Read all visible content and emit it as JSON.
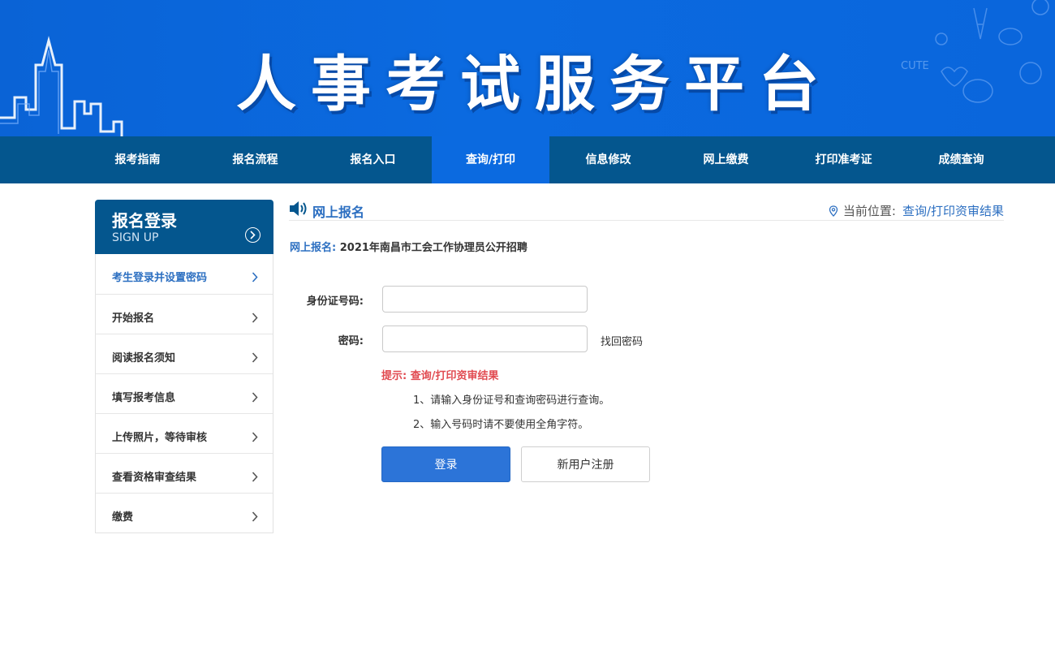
{
  "banner": {
    "title": "人事考试服务平台"
  },
  "nav": {
    "items": [
      "报考指南",
      "报名流程",
      "报名入口",
      "查询/打印",
      "信息修改",
      "网上缴费",
      "打印准考证",
      "成绩查询"
    ],
    "active_index": 3
  },
  "sidebar": {
    "title": "报名登录",
    "subtitle": "SIGN UP",
    "items": [
      "考生登录并设置密码",
      "开始报名",
      "阅读报名须知",
      "填写报考信息",
      "上传照片，等待审核",
      "查看资格审查结果",
      "缴费"
    ],
    "active_index": 0
  },
  "content": {
    "section_title": "网上报名",
    "breadcrumb_label": "当前位置:",
    "breadcrumb_current": "查询/打印资审结果",
    "exam_label": "网上报名:",
    "exam_name": "2021年南昌市工会工作协理员公开招聘"
  },
  "form": {
    "id_label": "身份证号码:",
    "id_value": "",
    "password_label": "密码:",
    "password_value": "",
    "recover_link": "找回密码",
    "hint": "提示: 查询/打印资审结果",
    "notes": [
      "1、请输入身份证号和查询密码进行查询。",
      "2、输入号码时请不要使用全角字符。"
    ],
    "login_button": "登录",
    "register_button": "新用户注册"
  },
  "colors": {
    "nav_bg": "#04568e",
    "accent": "#0b6ae0",
    "link": "#2c6fc1",
    "hint": "#e14a50",
    "button": "#2c74d8"
  }
}
